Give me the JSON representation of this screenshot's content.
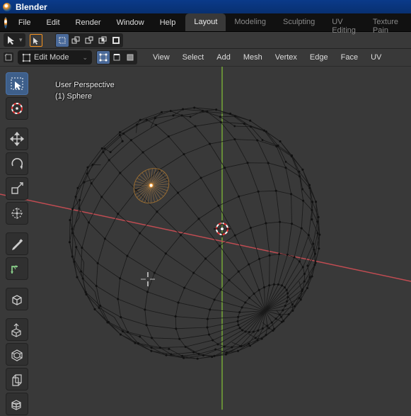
{
  "app": {
    "title": "Blender"
  },
  "menu": {
    "file": "File",
    "edit": "Edit",
    "render": "Render",
    "window": "Window",
    "help": "Help"
  },
  "workspaces": {
    "tabs": [
      {
        "label": "Layout",
        "active": true
      },
      {
        "label": "Modeling",
        "active": false
      },
      {
        "label": "Sculpting",
        "active": false
      },
      {
        "label": "UV Editing",
        "active": false
      },
      {
        "label": "Texture Pain",
        "active": false
      }
    ]
  },
  "header": {
    "mode": "Edit Mode",
    "view": "View",
    "select": "Select",
    "add": "Add",
    "mesh": "Mesh",
    "vertex": "Vertex",
    "edge": "Edge",
    "face": "Face",
    "uv": "UV"
  },
  "overlay": {
    "perspective": "User Perspective",
    "object": "(1) Sphere"
  },
  "colors": {
    "accent": "#f7931e",
    "axis_x": "#c14c52",
    "axis_y": "#75a838",
    "cursor_red": "#e33",
    "grid": "#4a4a4a"
  },
  "tooltips": {
    "cursor_tool": "cursor-tool",
    "select_box": "select-box",
    "move": "move",
    "rotate": "rotate",
    "scale": "scale",
    "transform": "transform",
    "annotate": "annotate",
    "measure": "measure",
    "add_cube": "add-cube",
    "extrude": "extrude-region",
    "inset": "inset-faces",
    "bevel": "bevel",
    "loop_cut": "loop-cut"
  }
}
